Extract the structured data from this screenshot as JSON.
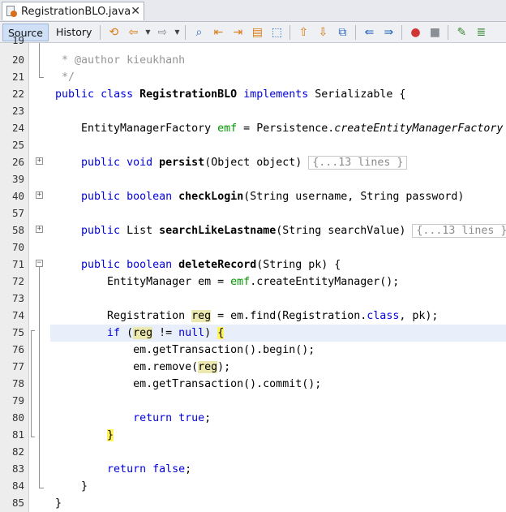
{
  "tab": {
    "title": "RegistrationBLO.java",
    "close": "✕"
  },
  "toolbar": {
    "source_label": "Source",
    "history_label": "History"
  },
  "lines": {
    "l19": "19",
    "l20": "20",
    "l21": "21",
    "l22": "22",
    "l23": "23",
    "l24": "24",
    "l25": "25",
    "l26": "26",
    "l39": "39",
    "l40": "40",
    "l57": "57",
    "l58": "58",
    "l70": "70",
    "l71": "71",
    "l72": "72",
    "l73": "73",
    "l74": "74",
    "l75": "75",
    "l76": "76",
    "l77": "77",
    "l78": "78",
    "l79": "79",
    "l80": "80",
    "l81": "81",
    "l82": "82",
    "l83": "83",
    "l84": "84",
    "l85": "85"
  },
  "code": {
    "c19": " *",
    "c20_star": " * ",
    "c20_author": "@author",
    "c20_name": " kieukhanh",
    "c21": " */",
    "c22_public": "public",
    "c22_class": "class",
    "c22_name": "RegistrationBLO",
    "c22_implements": "implements",
    "c22_tail": " Serializable {",
    "c24_type": "    EntityManagerFactory ",
    "c24_emf": "emf",
    "c24_mid": " = Persistence.",
    "c24_call": "createEntityManagerFactory",
    "c26_public": "public",
    "c26_void": "void",
    "c26_name": "persist",
    "c26_args": "(Object object) ",
    "c26_fold": "{...13 lines }",
    "c40_public": "public",
    "c40_boolean": "boolean",
    "c40_name": "checkLogin",
    "c40_args": "(String username, String password)",
    "c58_public": "public",
    "c58_type": " List ",
    "c58_name": "searchLikeLastname",
    "c58_args": "(String searchValue) ",
    "c58_fold": "{...13 lines }",
    "c71_public": "public",
    "c71_boolean": "boolean",
    "c71_name": "deleteRecord",
    "c71_args": "(String pk) {",
    "c72_a": "        EntityManager em = ",
    "c72_emf": "emf",
    "c72_b": ".createEntityManager();",
    "c74_a": "        Registration ",
    "c74_reg": "reg",
    "c74_b": " = em.find(Registration.",
    "c74_class": "class",
    "c74_c": ", pk);",
    "c75_if": "if",
    "c75_a": " (",
    "c75_reg": "reg",
    "c75_b": " != ",
    "c75_null": "null",
    "c75_c": ") ",
    "c75_brace": "{",
    "c76": "            em.getTransaction().begin();",
    "c77_a": "            em.remove(",
    "c77_reg": "reg",
    "c77_b": ");",
    "c78": "            em.getTransaction().commit();",
    "c80_return": "return",
    "c80_true": "true",
    "c80_semi": ";",
    "c81_brace": "}",
    "c83_return": "return",
    "c83_false": "false",
    "c83_semi": ";",
    "c84": "    }",
    "c85": "}"
  },
  "colors": {
    "keyword": "#0000e6",
    "comment": "#969696",
    "field": "#009900",
    "occurrence_highlight": "#ece9b0",
    "brace_match": "#fff45e",
    "current_line": "#e9effa"
  }
}
